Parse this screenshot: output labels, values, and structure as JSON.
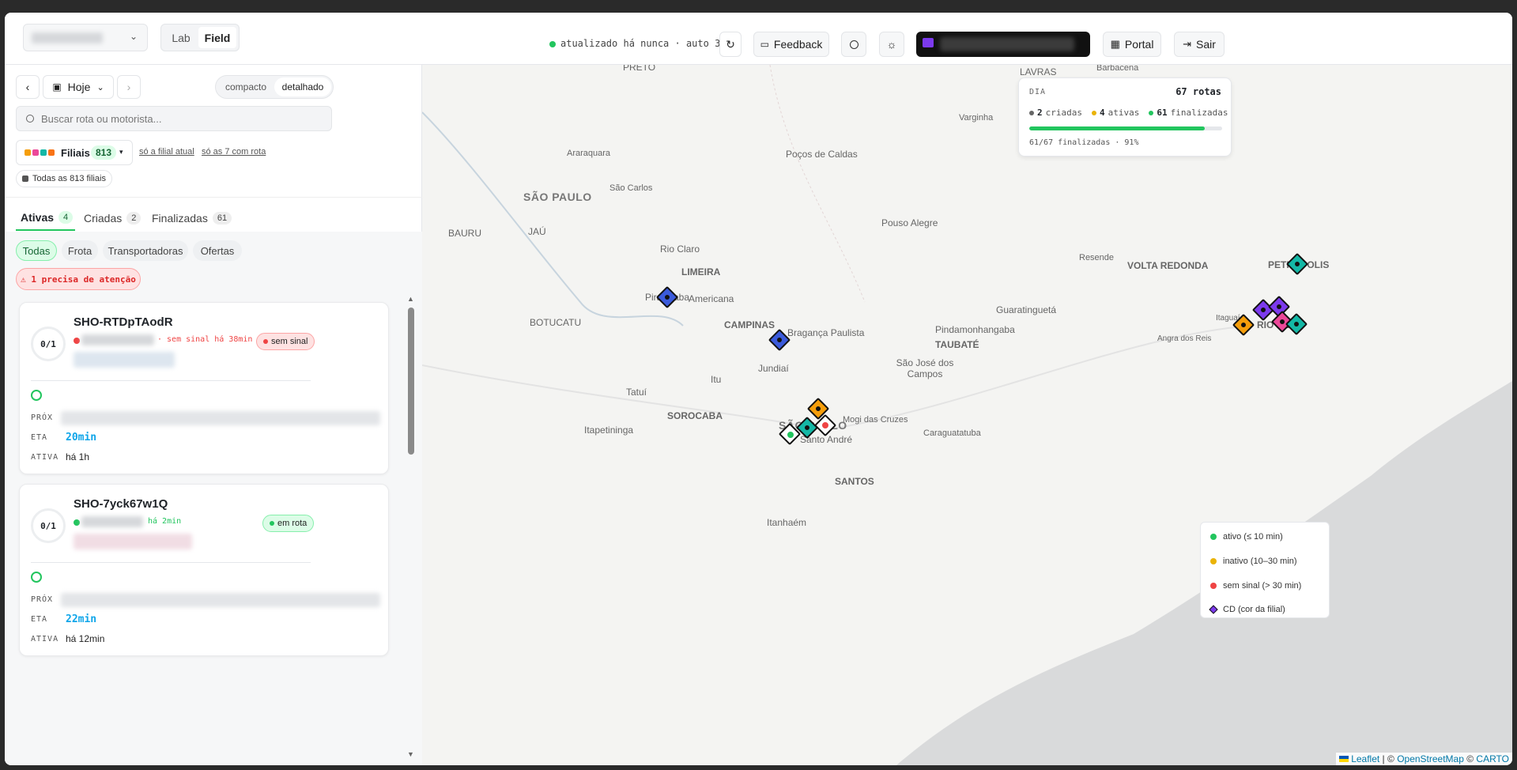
{
  "header": {
    "env_tabs": [
      "Lab",
      "Field"
    ],
    "status_text": "atualizado há nunca · auto 30s",
    "feedback_label": "Feedback",
    "portal_label": "Portal",
    "logout_label": "Sair"
  },
  "sidebar": {
    "date_label": "Hoje",
    "view_modes": [
      "compacto",
      "detalhado"
    ],
    "search_placeholder": "Buscar rota ou motorista...",
    "filiais": {
      "label": "Filiais",
      "count": "813",
      "link_current": "só a filial atual",
      "link_with_route": "só as 7 com rota",
      "chip": "Todas as 813 filiais"
    },
    "tabs": [
      {
        "label": "Ativas",
        "count": "4"
      },
      {
        "label": "Criadas",
        "count": "2"
      },
      {
        "label": "Finalizadas",
        "count": "61"
      }
    ],
    "filters": [
      "Todas",
      "Frota",
      "Transportadoras",
      "Ofertas"
    ],
    "alert": "⚠ 1 precisa de atenção",
    "cards": [
      {
        "id": "SHO-RTDpTAodR",
        "progress": "0/1",
        "signal": "· sem sinal há 38min",
        "badge": "sem sinal",
        "prox_label": "PRÓX",
        "eta_label": "ETA",
        "eta": "20min",
        "ativa_label": "ATIVA",
        "ativa": "há 1h"
      },
      {
        "id": "SHO-7yck67w1Q",
        "progress": "0/1",
        "signal": "há 2min",
        "badge": "em rota",
        "prox_label": "PRÓX",
        "eta_label": "ETA",
        "eta": "22min",
        "ativa_label": "ATIVA",
        "ativa": "há 12min"
      }
    ]
  },
  "day_panel": {
    "label": "DIA",
    "total": "67 rotas",
    "criadas": "2",
    "criadas_label": "criadas",
    "ativas": "4",
    "ativas_label": "ativas",
    "finalizadas": "61",
    "finalizadas_label": "finalizadas",
    "progress_text": "61/67 finalizadas · 91%",
    "progress_fraction": 0.91
  },
  "legend": {
    "items": [
      "ativo (≤ 10 min)",
      "inativo (10–30 min)",
      "sem sinal (> 30 min)",
      "CD (cor da filial)"
    ]
  },
  "attribution": {
    "leaflet": "Leaflet",
    "sep1": " | © ",
    "osm": "OpenStreetMap",
    "sep2": " © ",
    "carto": "CARTO"
  },
  "map_labels": {
    "cities": [
      "PRETO",
      "LAVRAS",
      "Barbacena",
      "Varginha",
      "Araraquara",
      "Poços de Caldas",
      "São Carlos",
      "SÃO PAULO",
      "BAURU",
      "JAÚ",
      "Pouso Alegre",
      "Resende",
      "VOLTA REDONDA",
      "PETRÓPOLIS",
      "Rio Claro",
      "LIMEIRA",
      "Piracicaba",
      "Americana",
      "Guaratinguetá",
      "BOTUCATU",
      "CAMPINAS",
      "Bragança Paulista",
      "Pindamonhangaba",
      "Itaguaí",
      "RIO DE",
      "Angra dos Reis",
      "TAUBATÉ",
      "São José dos Campos",
      "Jundiaí",
      "Tatuí",
      "Itu",
      "SOROCABA",
      "Itapetininga",
      "Mogi das Cruzes",
      "Santo André",
      "Caraguatatuba",
      "SÃO PAULO",
      "SANTOS",
      "Itanhaém"
    ]
  },
  "colors": {
    "active": "#22c55e",
    "inactive": "#eab308",
    "no_signal": "#ef4444",
    "accent": "#0ea5e9",
    "cd": "#7c3aed"
  }
}
